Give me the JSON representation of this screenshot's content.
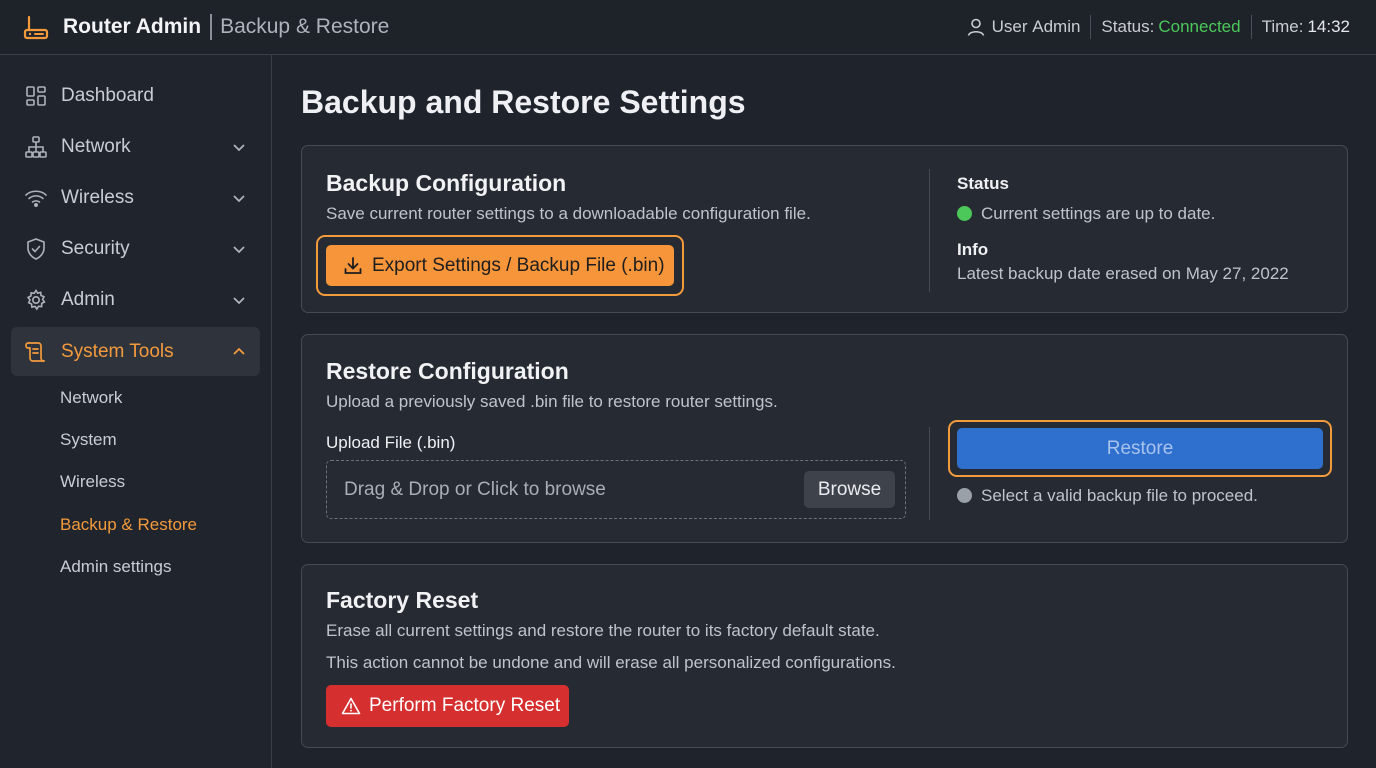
{
  "header": {
    "app_title": "Router Admin",
    "page_name": "Backup & Restore",
    "user_label": "User",
    "user_name": "Admin",
    "status_label": "Status:",
    "status_value": "Connected",
    "time_label": "Time:",
    "time_value": "14:32"
  },
  "sidebar": {
    "items": [
      {
        "label": "Dashboard",
        "icon": "dashboard-icon",
        "expandable": false
      },
      {
        "label": "Network",
        "icon": "network-icon",
        "expandable": true
      },
      {
        "label": "Wireless",
        "icon": "wifi-icon",
        "expandable": true
      },
      {
        "label": "Security",
        "icon": "shield-icon",
        "expandable": true
      },
      {
        "label": "Admin",
        "icon": "gear-icon",
        "expandable": true
      },
      {
        "label": "System Tools",
        "icon": "tools-icon",
        "expandable": true,
        "expanded": true,
        "active": true
      }
    ],
    "subitems": [
      {
        "label": "Network"
      },
      {
        "label": "System"
      },
      {
        "label": "Wireless"
      },
      {
        "label": "Backup & Restore",
        "active": true
      },
      {
        "label": "Admin settings"
      }
    ]
  },
  "main": {
    "title": "Backup and Restore Settings",
    "backup": {
      "title": "Backup Configuration",
      "description": "Save current router settings to a downloadable configuration file.",
      "export_button": "Export Settings / Backup File (.bin)",
      "status_label": "Status",
      "status_text": "Current settings are up to date.",
      "info_label": "Info",
      "info_text": "Latest backup date erased on May 27, 2022"
    },
    "restore": {
      "title": "Restore Configuration",
      "description": "Upload a previously saved .bin file to restore router settings.",
      "upload_label": "Upload File (.bin)",
      "dropzone_text": "Drag & Drop or Click to browse",
      "browse_button": "Browse",
      "restore_button": "Restore",
      "hint": "Select a valid backup file to proceed."
    },
    "factory_reset": {
      "title": "Factory Reset",
      "line1": "Erase all current settings and restore the router to its factory default state.",
      "line2": "This action cannot be undone and will erase all personalized configurations.",
      "button": "Perform Factory Reset"
    }
  },
  "colors": {
    "accent": "#f39a3c",
    "success": "#4cc85a",
    "primary": "#2f6fce",
    "danger": "#d5302f",
    "neutral_dot": "#9aa0a8"
  }
}
